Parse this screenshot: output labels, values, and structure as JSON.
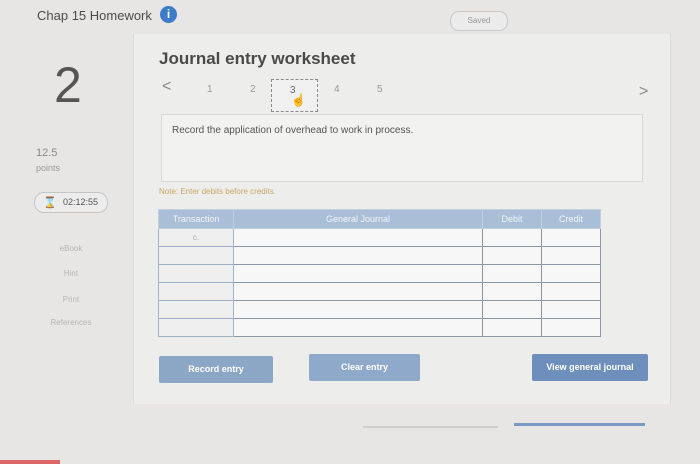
{
  "header": {
    "title": "Chap 15 Homework",
    "info_icon": "i",
    "saved": "Saved"
  },
  "question": {
    "number": "2",
    "points_value": "12.5",
    "points_label": "points",
    "timer": "02:12:55",
    "links": [
      "eBook",
      "Hint",
      "Print",
      "References"
    ]
  },
  "worksheet": {
    "title": "Journal entry worksheet",
    "prev": "<",
    "next": ">",
    "steps": [
      "1",
      "2",
      "3",
      "4",
      "5"
    ],
    "instruction": "Record the application of overhead to work in process.",
    "note": "Note: Enter debits before credits.",
    "table": {
      "headers": [
        "Transaction",
        "General Journal",
        "Debit",
        "Credit"
      ],
      "first_transaction": "c."
    },
    "buttons": {
      "record": "Record entry",
      "clear": "Clear entry",
      "view": "View general journal"
    }
  }
}
